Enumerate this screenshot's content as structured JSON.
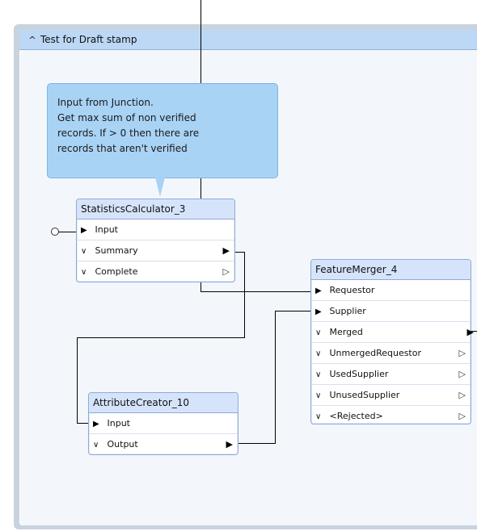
{
  "bookmark": {
    "title": "Test for Draft stamp",
    "collapse_icon": "chevron-up-icon"
  },
  "annotation": {
    "lines": [
      "Input from Junction.",
      "Get max sum of non verified",
      "records. If > 0 then there are",
      "records that aren't verified"
    ]
  },
  "transformers": {
    "statistics": {
      "name": "StatisticsCalculator_3",
      "input": "Input",
      "outputs": [
        "Summary",
        "Complete"
      ]
    },
    "merger": {
      "name": "FeatureMerger_4",
      "inputs": [
        "Requestor",
        "Supplier"
      ],
      "outputs": [
        "Merged",
        "UnmergedRequestor",
        "UsedSupplier",
        "UnusedSupplier",
        "<Rejected>"
      ]
    },
    "creator": {
      "name": "AttributeCreator_10",
      "input": "Input",
      "outputs": [
        "Output"
      ]
    }
  },
  "colors": {
    "annotation": "#a9d3f5",
    "bookmark_header": "#bcd8f5",
    "transformer_header": "#d6e4fb",
    "transformer_border": "#8fa9d8"
  }
}
